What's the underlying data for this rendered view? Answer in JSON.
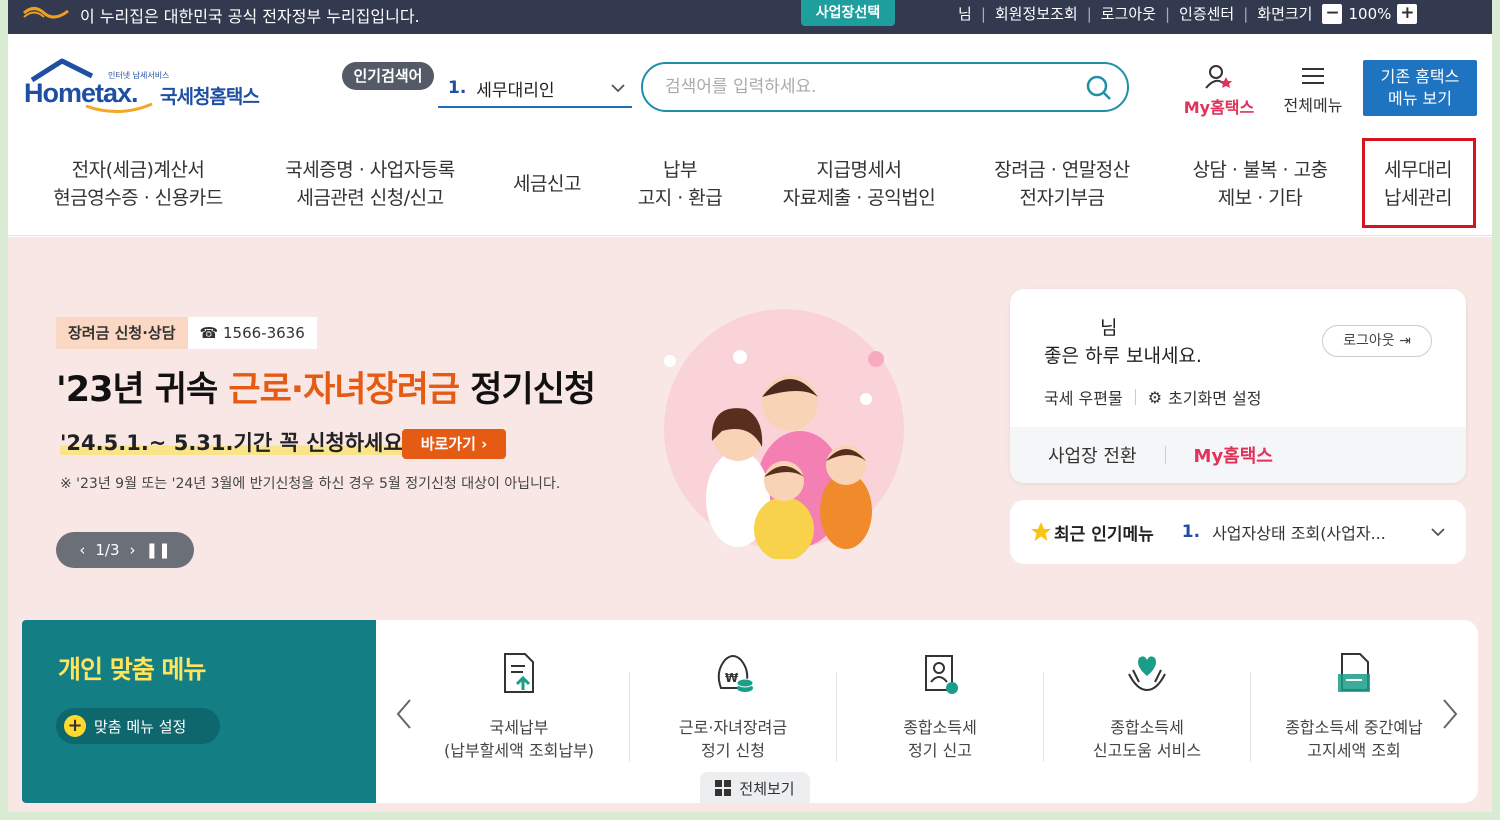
{
  "gov_bar": {
    "notice": "이 누리집은 대한민국 공식 전자정부 누리집입니다.",
    "biz_select": "사업장선택",
    "user_suffix": "님",
    "links": [
      "회원정보조회",
      "로그아웃",
      "인증센터",
      "화면크기"
    ],
    "zoom_minus": "−",
    "zoom_value": "100%",
    "zoom_plus": "+"
  },
  "header": {
    "logo_small": "인터넷 납세서비스",
    "logo_word": "Hometax.",
    "logo_kor": "국세청홈택스",
    "popular_label": "인기검색어",
    "popular_num": "1.",
    "popular_term": "세무대리인",
    "search_placeholder": "검색어를 입력하세요.",
    "my_hometax": "My홈택스",
    "all_menu": "전체메뉴",
    "old_menu_line1": "기존 홈택스",
    "old_menu_line2": "메뉴 보기"
  },
  "nav": [
    {
      "line1": "전자(세금)계산서",
      "line2": "현금영수증 · 신용카드"
    },
    {
      "line1": "국세증명 · 사업자등록",
      "line2": "세금관련 신청/신고"
    },
    {
      "line1": "세금신고",
      "line2": ""
    },
    {
      "line1": "납부",
      "line2": "고지 · 환급"
    },
    {
      "line1": "지급명세서",
      "line2": "자료제출 · 공익법인"
    },
    {
      "line1": "장려금 · 연말정산",
      "line2": "전자기부금"
    },
    {
      "line1": "상담 · 불복 · 고충",
      "line2": "제보 · 기타"
    },
    {
      "line1": "세무대리",
      "line2": "납세관리"
    }
  ],
  "hero": {
    "badge": "장려금 신청·상담",
    "phone": "☎ 1566-3636",
    "title_pre": "'23년 귀속 ",
    "title_hl": "근로·자녀장려금",
    "title_post": " 정기신청",
    "sub": "'24.5.1.~ 5.31.기간 꼭 신청하세요!",
    "go_button": "바로가기  ›",
    "note": "※ '23년 9월 또는 '24년 3월에 반기신청을 하신 경우 5월 정기신청 대상이 아닙니다.",
    "pager": "1/3"
  },
  "user_card": {
    "name_suffix": "님",
    "greeting": "좋은 하루 보내세요.",
    "logout": "로그아웃",
    "mail": "국세 우편물",
    "home_setting": "초기화면 설정",
    "switch_biz": "사업장 전환",
    "my_hometax": "My홈택스"
  },
  "hot_menu": {
    "title": "최근 인기메뉴",
    "num": "1.",
    "item": "사업자상태 조회(사업자..."
  },
  "custom_menu": {
    "title": "개인 맞춤 메뉴",
    "setting": "맞춤 메뉴 설정",
    "items": [
      {
        "line1": "국세납부",
        "line2": "(납부할세액 조회납부)"
      },
      {
        "line1": "근로·자녀장려금",
        "line2": "정기 신청"
      },
      {
        "line1": "종합소득세",
        "line2": "정기 신고"
      },
      {
        "line1": "종합소득세",
        "line2": "신고도움 서비스"
      },
      {
        "line1": "종합소득세 중간예납",
        "line2": "고지세액 조회"
      }
    ],
    "all_view": "전체보기"
  },
  "colors": {
    "gov_bar": "#333a4f",
    "brand_blue": "#1f4fa3",
    "accent_orange": "#e65b14",
    "pink": "#e0325b",
    "teal": "#137e84",
    "highlight_red": "#d4141f"
  }
}
